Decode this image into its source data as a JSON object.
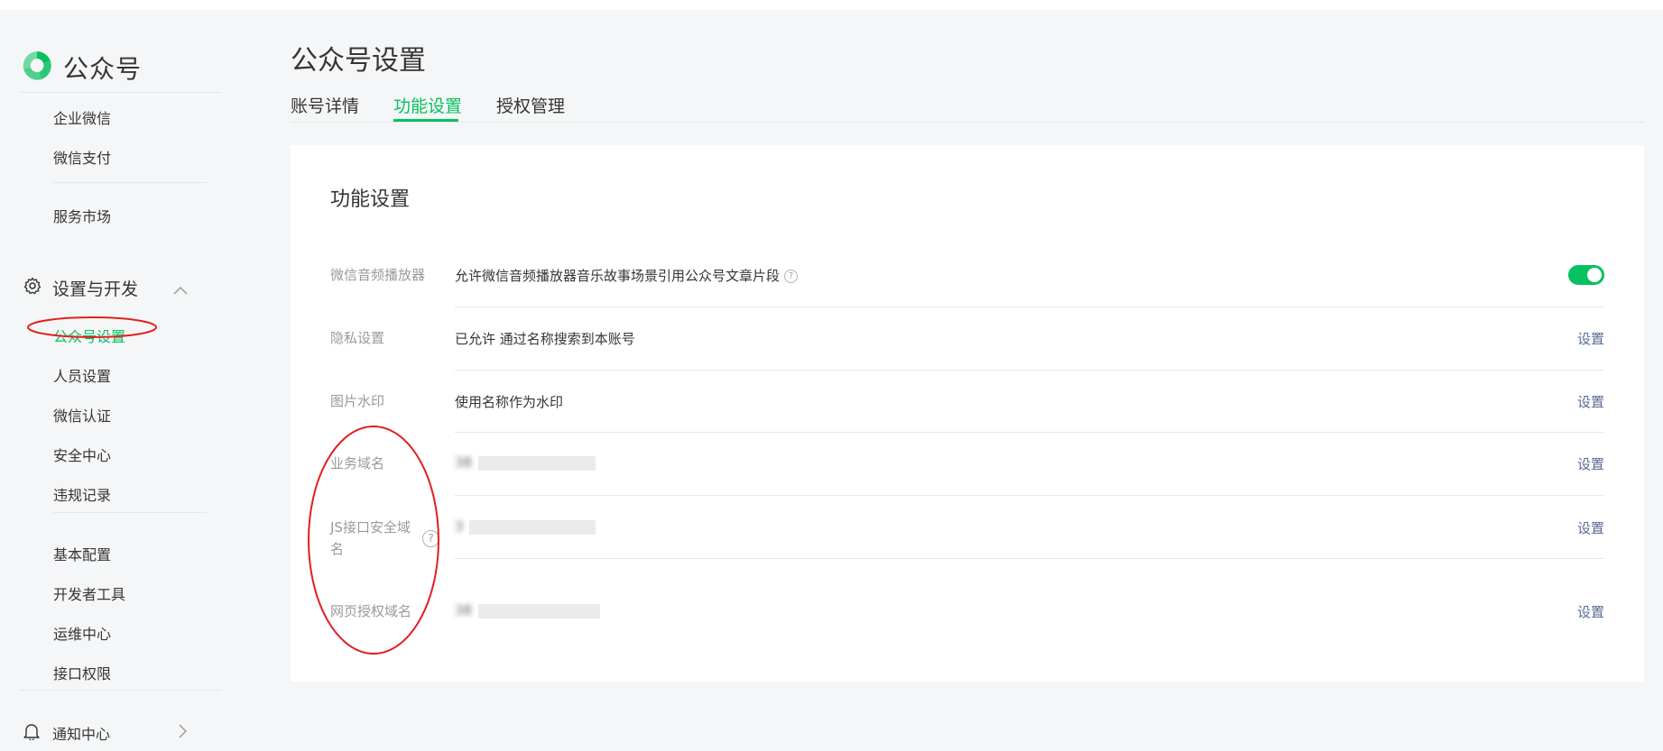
{
  "brand": {
    "name": "公众号",
    "accent": "#07c160"
  },
  "sidebar": {
    "items_top": [
      {
        "label": "企业微信"
      },
      {
        "label": "微信支付"
      },
      {
        "label": "服务市场"
      }
    ],
    "group": {
      "label": "设置与开发"
    },
    "group_items": [
      {
        "label": "公众号设置"
      },
      {
        "label": "人员设置"
      },
      {
        "label": "微信认证"
      },
      {
        "label": "安全中心"
      },
      {
        "label": "违规记录"
      }
    ],
    "dev_items": [
      {
        "label": "基本配置"
      },
      {
        "label": "开发者工具"
      },
      {
        "label": "运维中心"
      },
      {
        "label": "接口权限"
      }
    ],
    "notify": {
      "label": "通知中心"
    }
  },
  "header": {
    "title": "公众号设置",
    "tabs": [
      {
        "label": "账号详情"
      },
      {
        "label": "功能设置"
      },
      {
        "label": "授权管理"
      }
    ]
  },
  "card": {
    "title": "功能设置",
    "rows": [
      {
        "label": "微信音频播放器",
        "value": "允许微信音频播放器音乐故事场景引用公众号文章片段"
      },
      {
        "label": "隐私设置",
        "value": "已允许 通过名称搜索到本账号",
        "action": "设置"
      },
      {
        "label": "图片水印",
        "value": "使用名称作为水印",
        "action": "设置"
      },
      {
        "label": "业务域名",
        "value": "38",
        "action": "设置"
      },
      {
        "label_line1": "JS接口安全域",
        "label_line2": "名",
        "value": "3",
        "action": "设置"
      },
      {
        "label": "网页授权域名",
        "value": "38",
        "action": "设置"
      }
    ]
  },
  "colors": {
    "link": "#576b95",
    "annotation": "#e02020"
  }
}
